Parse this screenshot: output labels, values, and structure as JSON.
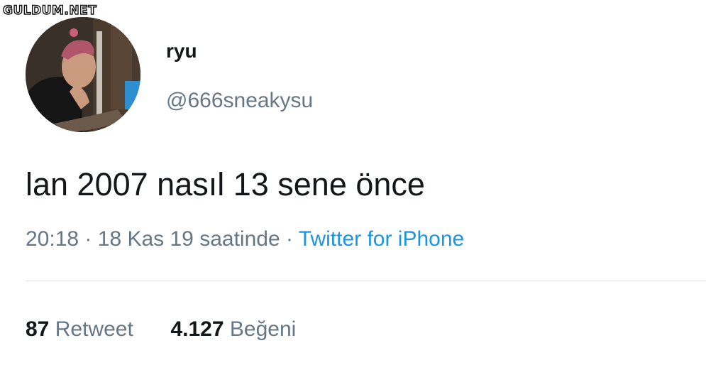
{
  "watermark": "GULDUM.NET",
  "tweet": {
    "author": {
      "display_name": "ryu",
      "handle": "@666sneakysu"
    },
    "text": "lan 2007 nasıl 13 sene önce",
    "time": "20:18",
    "date": "18 Kas 19 saatinde",
    "separator": "·",
    "source": "Twitter for iPhone",
    "stats": {
      "retweets": "87",
      "retweets_label": "Retweet",
      "likes": "4.127",
      "likes_label": "Beğeni"
    }
  },
  "colors": {
    "text": "#14171a",
    "secondary": "#657786",
    "link": "#1b95e0",
    "divider": "#e1e8ed"
  }
}
